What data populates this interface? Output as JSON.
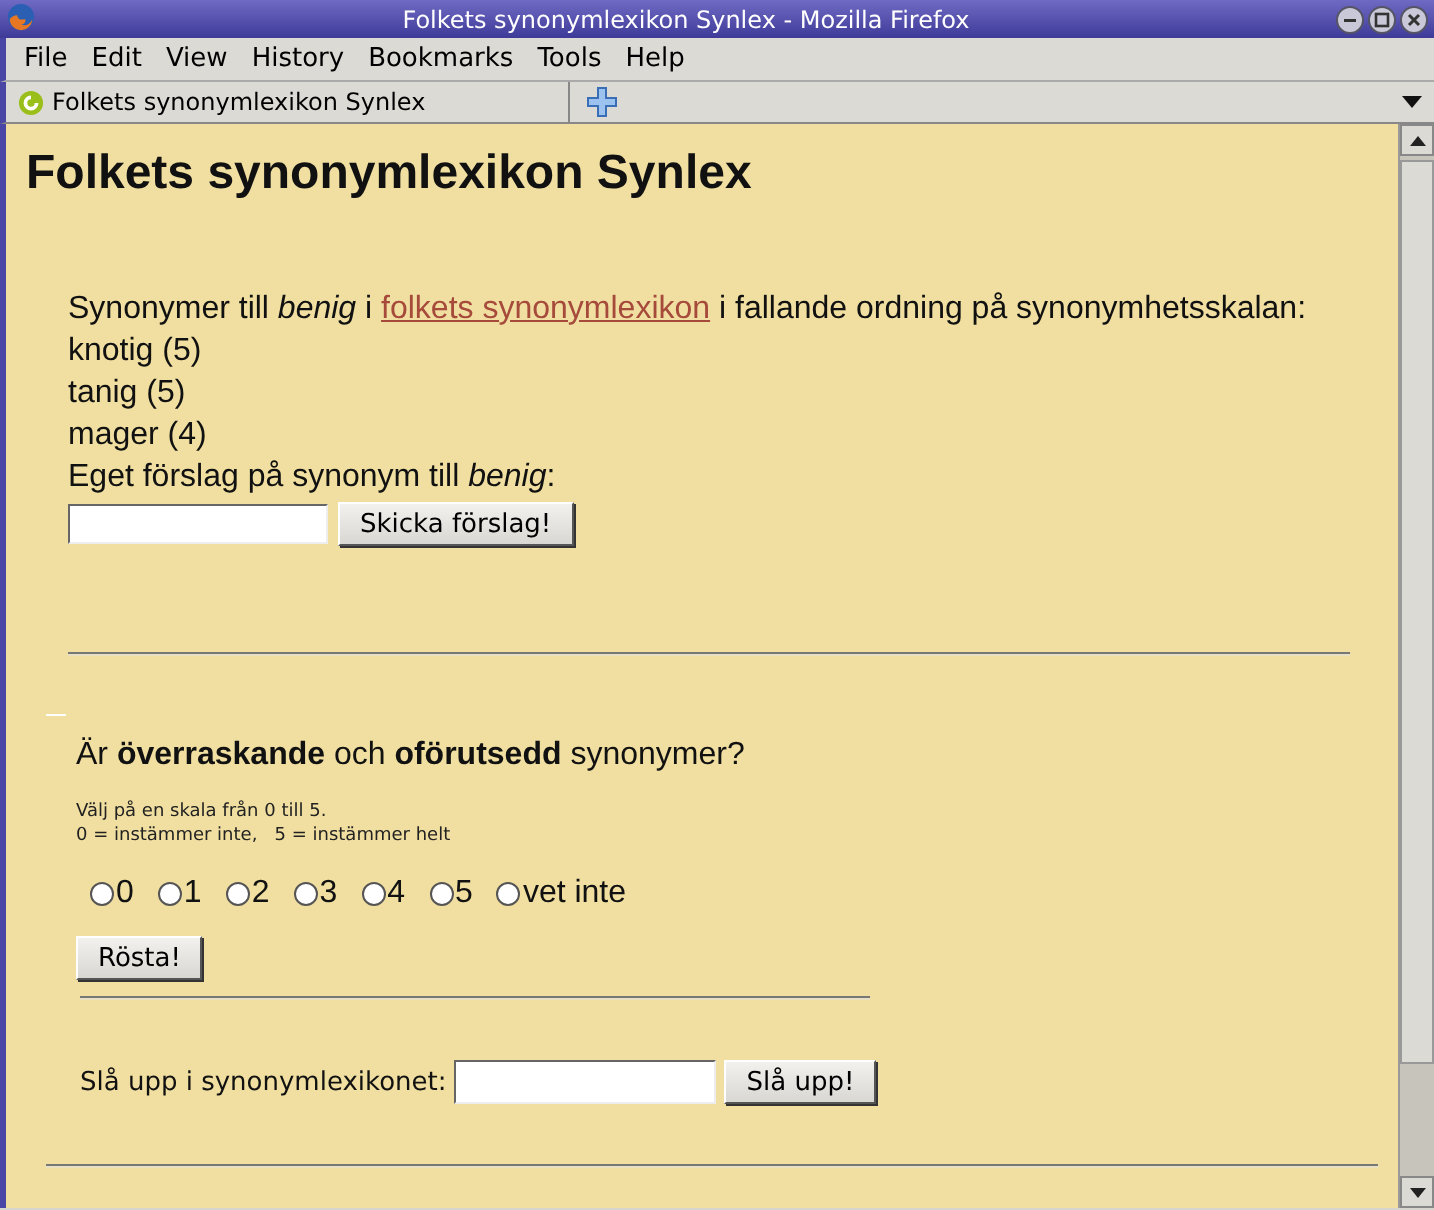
{
  "window": {
    "title": "Folkets synonymlexikon Synlex - Mozilla Firefox"
  },
  "menu": [
    {
      "label": "File"
    },
    {
      "label": "Edit"
    },
    {
      "label": "View"
    },
    {
      "label": "History"
    },
    {
      "label": "Bookmarks"
    },
    {
      "label": "Tools"
    },
    {
      "label": "Help"
    }
  ],
  "tabs": [
    {
      "label": "Folkets synonymlexikon Synlex",
      "selected": true
    }
  ],
  "page": {
    "heading": "Folkets synonymlexikon Synlex",
    "intro": {
      "before": "Synonymer till *benig* i ",
      "link": "folkets synonymlexikon",
      "after": " i fallande ordning på synonymhetsskalan:"
    },
    "synonyms": [
      "knotig (5)",
      "tanig (5)",
      "mager (4)"
    ],
    "suggestion_label": "Eget förslag på synonym till *benig*:",
    "suggest_button": "Skicka förslag!",
    "question": "Är **överraskande** och **oförutsedd** synonymer?",
    "instructions": [
      "Välj på en skala från 0 till 5.",
      "0 = instämmer inte,   5 = instämmer helt"
    ],
    "choices": [
      {
        "label": "0",
        "selected": false
      },
      {
        "label": "1",
        "selected": false
      },
      {
        "label": "2",
        "selected": false
      },
      {
        "label": "3",
        "selected": false
      },
      {
        "label": "4",
        "selected": false
      },
      {
        "label": "5",
        "selected": false
      },
      {
        "label": "vet inte",
        "selected": false
      }
    ],
    "vote_button": "Rösta!",
    "lookup_label": "Slå upp i synonymlexikonet:",
    "lookup_button": "Slå upp!"
  }
}
